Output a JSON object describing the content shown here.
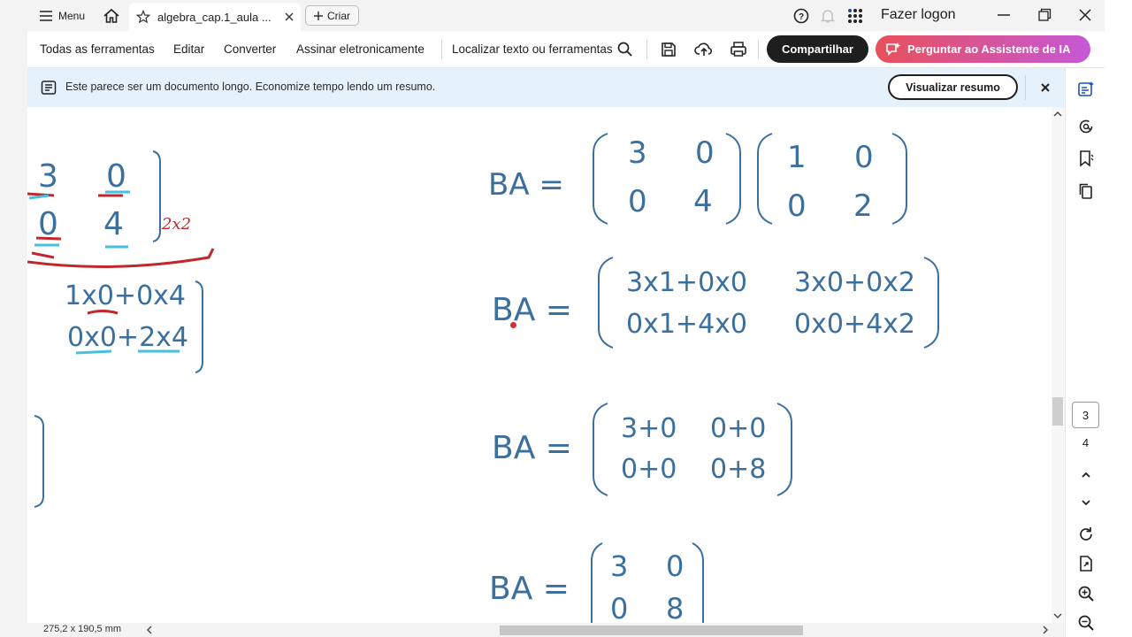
{
  "titlebar": {
    "menu_label": "Menu",
    "tab_title": "algebra_cap.1_aula ...",
    "create_label": "Criar",
    "signin_label": "Fazer logon"
  },
  "toolbar": {
    "all_tools": "Todas as ferramentas",
    "edit": "Editar",
    "convert": "Converter",
    "sign": "Assinar eletronicamente",
    "find": "Localizar texto ou ferramentas",
    "share": "Compartilhar",
    "ai_assistant": "Perguntar ao Assistente de IA"
  },
  "banner": {
    "message": "Este parece ser um documento longo. Economize tempo lendo um resumo.",
    "view_summary": "Visualizar resumo"
  },
  "document": {
    "left_matrix": [
      "3",
      "0",
      "0",
      "4"
    ],
    "left_annotation": "2x2",
    "left_product": [
      "1x0+0x4",
      "0x0+2x4"
    ],
    "eq1": {
      "lhs": "BA =",
      "m1": [
        "3",
        "0",
        "0",
        "4"
      ],
      "m2": [
        "1",
        "0",
        "0",
        "2"
      ]
    },
    "eq2": {
      "lhs": "BA =",
      "m": [
        "3x1+0x0",
        "3x0+0x2",
        "0x1+4x0",
        "0x0+4x2"
      ]
    },
    "eq3": {
      "lhs": "BA =",
      "m": [
        "3+0",
        "0+0",
        "0+0",
        "0+8"
      ]
    },
    "eq4": {
      "lhs": "BA =",
      "m": [
        "3",
        "0",
        "0",
        "8"
      ]
    }
  },
  "navigation": {
    "current_page": "3",
    "total_pages": "4"
  },
  "status": {
    "page_size": "275,2 x 190,5 mm"
  }
}
